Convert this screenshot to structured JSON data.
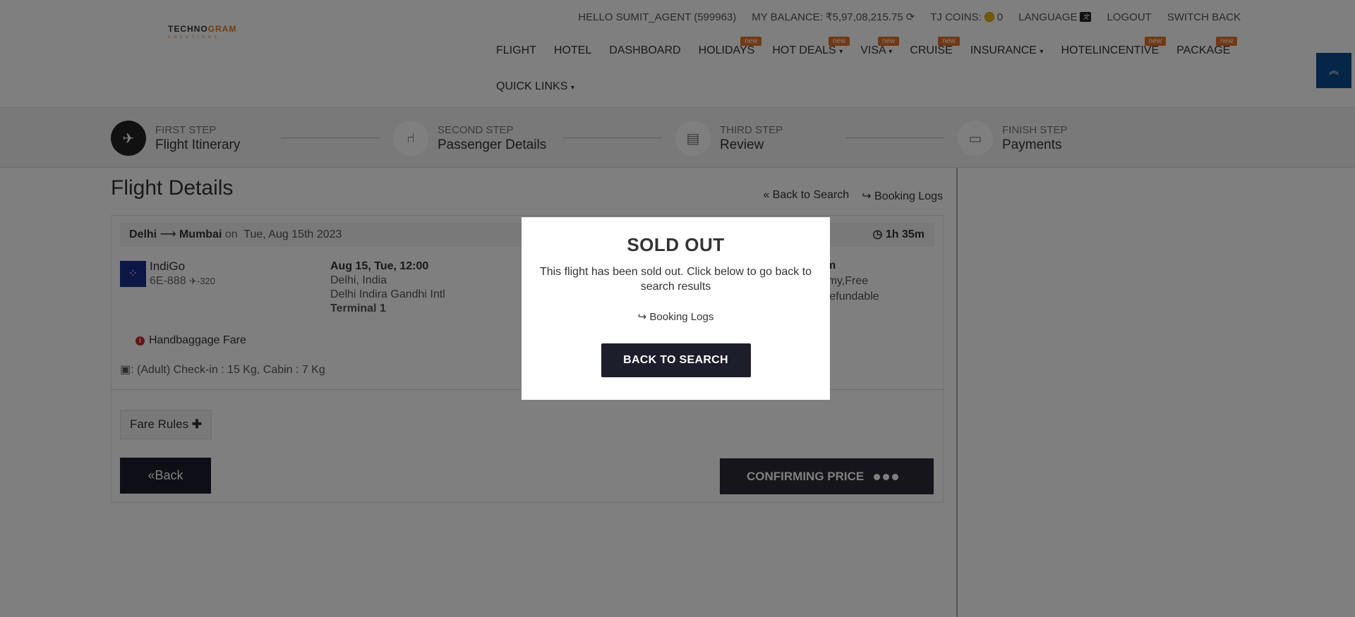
{
  "header": {
    "logo_top": "TECHNO",
    "logo_top_accent": "GRAM",
    "logo_sub": "SOLUTIONS",
    "greeting": "HELLO SUMIT_AGENT (599963)",
    "balance": "MY BALANCE: ₹5,97,08,215.75",
    "tj_coins_label": "TJ COINS:",
    "tj_coins_value": "0",
    "language": "LANGUAGE",
    "logout": "LOGOUT",
    "switch_back": "SWITCH BACK",
    "nav": [
      {
        "label": "FLIGHT",
        "badge": ""
      },
      {
        "label": "HOTEL",
        "badge": ""
      },
      {
        "label": "DASHBOARD",
        "badge": ""
      },
      {
        "label": "HOLIDAYS",
        "badge": "new"
      },
      {
        "label": "HOT DEALS",
        "badge": "new"
      },
      {
        "label": "VISA",
        "badge": "new"
      },
      {
        "label": "CRUISE",
        "badge": "new"
      },
      {
        "label": "INSURANCE",
        "badge": ""
      },
      {
        "label": "HOTELINCENTIVE",
        "badge": "new"
      },
      {
        "label": "PACKAGE",
        "badge": "new"
      }
    ],
    "quick_links": "QUICK LINKS"
  },
  "steps": [
    {
      "kicker": "FIRST STEP",
      "title": "Flight Itinerary",
      "icon": "plane-icon"
    },
    {
      "kicker": "SECOND STEP",
      "title": "Passenger Details",
      "icon": "seat-icon"
    },
    {
      "kicker": "THIRD STEP",
      "title": "Review",
      "icon": "document-icon"
    },
    {
      "kicker": "FINISH STEP",
      "title": "Payments",
      "icon": "card-icon"
    }
  ],
  "main": {
    "title": "Flight Details",
    "back_to_search": "Back to Search",
    "booking_logs": "Booking Logs",
    "route_from": "Delhi",
    "route_to": "Mumbai",
    "route_on": "on",
    "route_date": "Tue, Aug 15th 2023",
    "duration": "1h 35m",
    "airline": "IndiGo",
    "flight_no": "6E-888",
    "aircraft": "-320",
    "dep_datetime": "Aug 15, Tue, 12:00",
    "dep_city": "Delhi, India",
    "dep_airport": "Delhi Indira Gandhi Intl",
    "dep_terminal": "Terminal 1",
    "right_duration": "h 35m",
    "right_class": "conomy,Free",
    "right_fare": "eal,Refundable",
    "handbag": "Handbaggage Fare",
    "baggage": ": (Adult) Check-in : 15 Kg, Cabin : 7 Kg",
    "fare_rules": "Fare Rules",
    "back": "Back",
    "confirm": "CONFIRMING PRICE"
  },
  "modal": {
    "title": "SOLD OUT",
    "text": "This flight has been sold out. Click below to go back to search results",
    "booking_logs": "Booking Logs",
    "button": "BACK TO SEARCH"
  }
}
